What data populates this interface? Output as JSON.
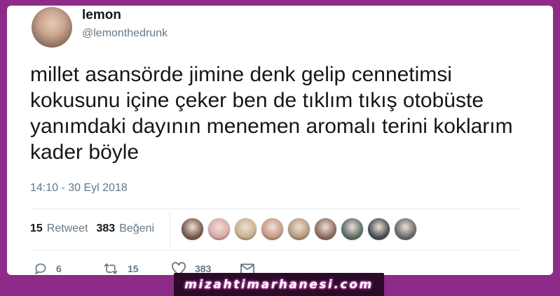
{
  "user": {
    "display_name": "lemon",
    "handle": "@lemonthedrunk"
  },
  "tweet": {
    "text": "millet asansörde jimine denk gelip cennetimsi kokusunu içine çeker ben de tıklım tıkış otobüste yanımdaki dayının menemen aromalı terini koklarım kader böyle",
    "timestamp": "14:10 - 30 Eyl 2018"
  },
  "stats": {
    "retweet_count": "15",
    "retweet_label": "Retweet",
    "like_count": "383",
    "like_label": "Beğeni"
  },
  "likers": [
    {
      "color": "#7a5a4e"
    },
    {
      "color": "#d9a9a6"
    },
    {
      "color": "#c9b18d"
    },
    {
      "color": "#c79a82"
    },
    {
      "color": "#b59a7a"
    },
    {
      "color": "#8c6e60"
    },
    {
      "color": "#5a6e68"
    },
    {
      "color": "#4a4f55"
    },
    {
      "color": "#6a6a6a"
    }
  ],
  "actions": {
    "reply_count": "6",
    "retweet_count": "15",
    "like_count": "383"
  },
  "watermark": "mizahtimarhanesi.com",
  "colors": {
    "background": "#8e2a87",
    "muted_text": "#657786",
    "primary_text": "#14171a"
  }
}
